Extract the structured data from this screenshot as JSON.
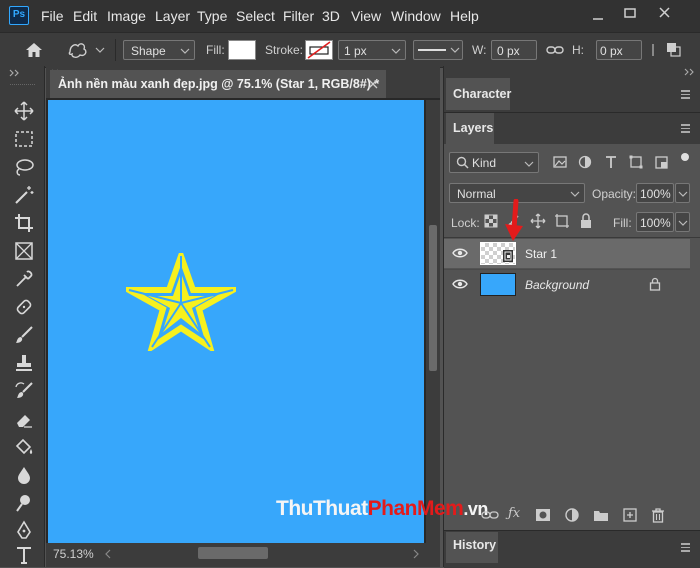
{
  "app": {
    "logo": "Ps"
  },
  "menu": [
    "File",
    "Edit",
    "Image",
    "Layer",
    "Type",
    "Select",
    "Filter",
    "3D",
    "View",
    "Window",
    "Help"
  ],
  "options": {
    "mode": "Shape",
    "fill_label": "Fill:",
    "stroke_label": "Stroke:",
    "stroke_width": "1 px",
    "w_label": "W:",
    "w_value": "0 px",
    "h_label": "H:",
    "h_value": "0 px"
  },
  "document": {
    "tab_title": "Ảnh nền màu xanh đẹp.jpg @ 75.1% (Star 1, RGB/8#) *",
    "zoom": "75.13%",
    "canvas_color": "#37a7fb",
    "star_color": "#f7f01e"
  },
  "panels": {
    "character_tab": "Character",
    "layers_tab": "Layers",
    "history_tab": "History",
    "filter_kind": "Kind",
    "blend_mode": "Normal",
    "opacity_label": "Opacity:",
    "opacity_value": "100%",
    "lock_label": "Lock:",
    "fill_label": "Fill:",
    "fill_value": "100%"
  },
  "layers": [
    {
      "name": "Star 1",
      "selected": true,
      "visible": true
    },
    {
      "name": "Background",
      "selected": false,
      "visible": true,
      "locked": true
    }
  ],
  "watermark": {
    "part1": "ThuThuat",
    "part2": "PhanMem",
    "part3": ".vn"
  }
}
